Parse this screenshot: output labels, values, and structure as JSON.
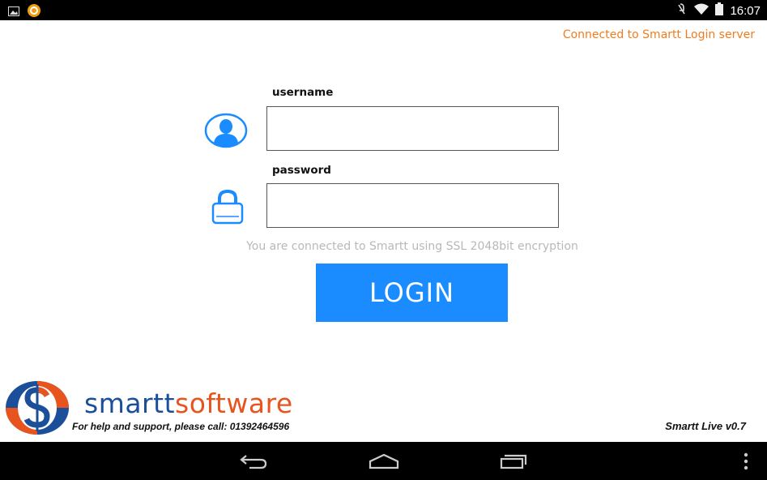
{
  "status_bar": {
    "time": "16:07",
    "icons": [
      "gallery-icon",
      "app-notification-icon",
      "mute-icon",
      "wifi-icon",
      "battery-icon"
    ]
  },
  "connection_status": "Connected to Smartt Login server",
  "form": {
    "username_label": "username",
    "username_value": "",
    "password_label": "password",
    "password_value": "",
    "ssl_note": "You are connected to Smartt using SSL 2048bit encryption",
    "login_label": "LOGIN"
  },
  "footer": {
    "brand_part1": "smartt",
    "brand_part2": "software",
    "support": "For help and support, please call: 01392464596",
    "version": "Smartt Live v0.7"
  },
  "colors": {
    "accent": "#1a8cff",
    "status_text": "#f07c1d",
    "brand_blue": "#1b4f9a",
    "brand_orange": "#e8541e"
  },
  "nav_bar": {
    "icons": [
      "back-icon",
      "home-icon",
      "recent-apps-icon",
      "overflow-menu-icon"
    ]
  }
}
